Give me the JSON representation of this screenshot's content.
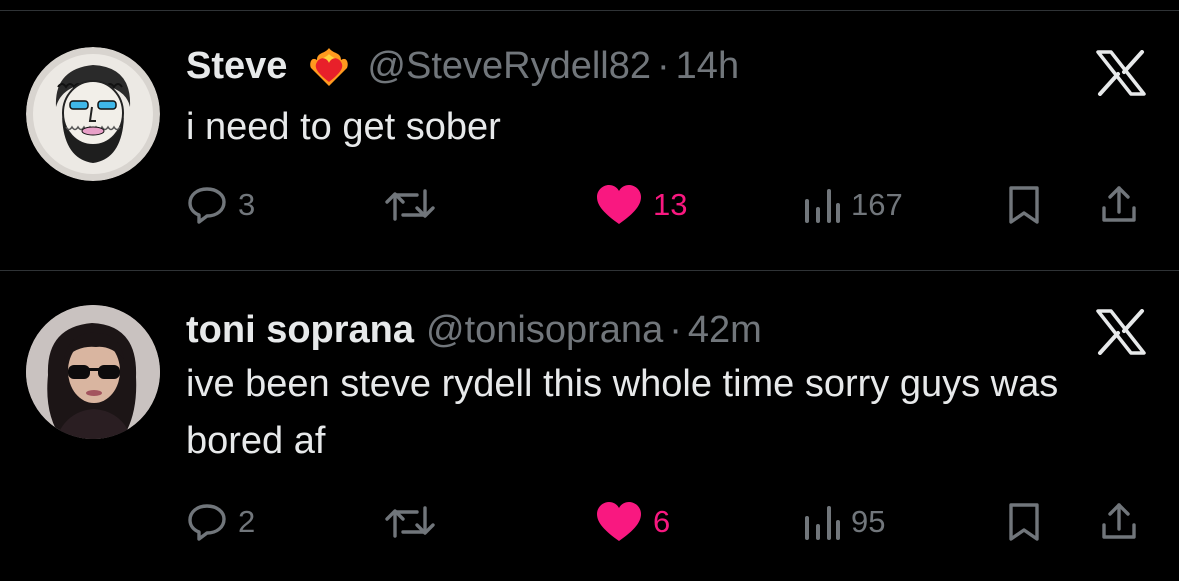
{
  "colors": {
    "background": "#000000",
    "text": "#e7e9ea",
    "muted": "#71767b",
    "like": "#f91880",
    "divider": "#2f3336"
  },
  "tweets": [
    {
      "name": "Steve",
      "badge_icon": "heart-on-fire-emoji",
      "handle": "@SteveRydell82",
      "separator": "·",
      "time": "14h",
      "text": "i need to get sober",
      "reply_count": "3",
      "retweet_count": "",
      "like_count": "13",
      "liked": true,
      "view_count": "167"
    },
    {
      "name": "toni soprana",
      "handle": "@tonisoprana",
      "separator": "·",
      "time": "42m",
      "text": "ive been steve rydell this whole time sorry guys was bored af",
      "reply_count": "2",
      "retweet_count": "",
      "like_count": "6",
      "liked": true,
      "view_count": "95"
    }
  ]
}
